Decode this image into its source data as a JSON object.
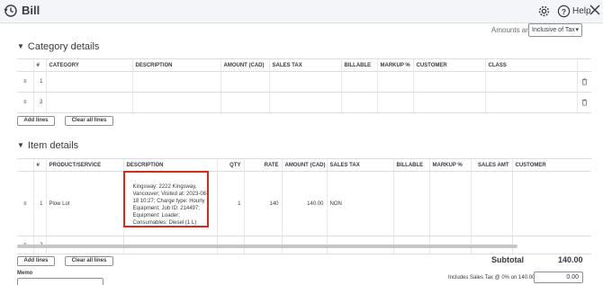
{
  "header": {
    "title": "Bill",
    "help_label": "Help"
  },
  "amounts": {
    "label": "Amounts are",
    "selected": "Inclusive of Tax"
  },
  "category_details": {
    "title": "Category details",
    "columns": [
      "#",
      "CATEGORY",
      "DESCRIPTION",
      "AMOUNT (CAD)",
      "SALES TAX",
      "BILLABLE",
      "MARKUP %",
      "CUSTOMER",
      "CLASS"
    ],
    "rows": [
      {
        "num": "1"
      },
      {
        "num": "2"
      }
    ],
    "add_lines": "Add lines",
    "clear_lines": "Clear all lines"
  },
  "item_details": {
    "title": "Item details",
    "columns": [
      "#",
      "PRODUCT/SERVICE",
      "DESCRIPTION",
      "QTY",
      "RATE",
      "AMOUNT (CAD)",
      "SALES TAX",
      "BILLABLE",
      "MARKUP %",
      "SALES AMT",
      "CUSTOMER"
    ],
    "rows": [
      {
        "num": "1",
        "product": "Plow Lot",
        "description": "Kingsway; 2222 Kingsway, Vancouver; Visited at: 2023-08-18 10:27; Charge type: Hourly Equipment; Job ID: 214497; Equipment: Loader; Consumables: Diesel (1 L)",
        "qty": "1",
        "rate": "140",
        "amount": "140.00",
        "sales_tax": "NON"
      },
      {
        "num": "2"
      }
    ],
    "add_lines": "Add lines",
    "clear_lines": "Clear all lines"
  },
  "totals": {
    "subtotal_label": "Subtotal",
    "subtotal_value": "140.00",
    "tax_label": "Includes Sales Tax @ 0% on 140.00",
    "tax_value": "0.00"
  },
  "memo": {
    "label": "Memo"
  },
  "colors": {
    "highlight": "#d52b1e",
    "border": "#dcdee2",
    "text": "#393a3d"
  }
}
